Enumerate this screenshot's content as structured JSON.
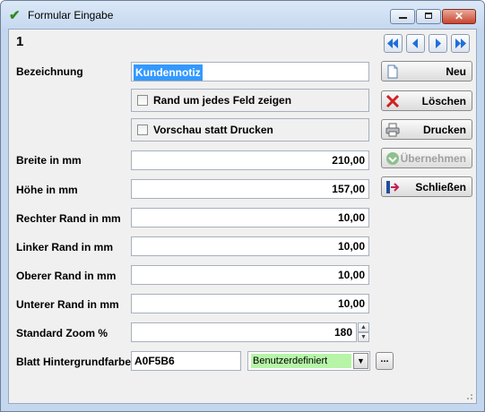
{
  "window": {
    "title": "Formular Eingabe",
    "controls": {
      "minimize": "minimize-icon",
      "maximize": "maximize-icon",
      "close": "close-icon"
    }
  },
  "record": {
    "number": "1",
    "nav": [
      "first-record-icon",
      "previous-record-icon",
      "next-record-icon",
      "last-record-icon"
    ]
  },
  "form": {
    "bezeichnung": {
      "label": "Bezeichnung",
      "value": "Kundennotiz"
    },
    "rand_checkbox": {
      "label": "Rand um jedes Feld zeigen",
      "checked": false
    },
    "vorschau_checkbox": {
      "label": "Vorschau statt Drucken",
      "checked": false
    },
    "breite": {
      "label": "Breite in mm",
      "value": "210,00"
    },
    "hoehe": {
      "label": "Höhe in mm",
      "value": "157,00"
    },
    "rechter_rand": {
      "label": "Rechter Rand in mm",
      "value": "10,00"
    },
    "linker_rand": {
      "label": "Linker Rand in mm",
      "value": "10,00"
    },
    "oberer_rand": {
      "label": "Oberer Rand in mm",
      "value": "10,00"
    },
    "unterer_rand": {
      "label": "Unterer Rand in mm",
      "value": "10,00"
    },
    "zoom": {
      "label": "Standard Zoom %",
      "value": "180"
    },
    "hintergrund": {
      "label": "Blatt Hintergrundfarbe",
      "hex": "A0F5B6",
      "selection": "Benutzerdefiniert",
      "swatch_color": "#b6f5a8",
      "more_label": "..."
    }
  },
  "actions": {
    "neu": "Neu",
    "loeschen": "Löschen",
    "drucken": "Drucken",
    "uebernehmen": "Übernehmen",
    "schliessen": "Schließen"
  },
  "colors": {
    "titlebar": "#c6d9f0",
    "client_bg": "#f0f0f0",
    "selection": "#3399ff",
    "nav_arrow": "#1e6fd9",
    "delete_red": "#d32020"
  }
}
